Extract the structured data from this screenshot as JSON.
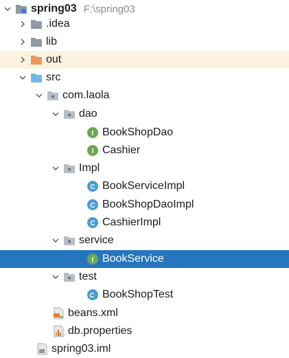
{
  "tree": {
    "root": {
      "name": "spring03",
      "path": "F:\\spring03"
    },
    "idea": ".idea",
    "lib": "lib",
    "out": "out",
    "src": "src",
    "pkg": "com.laola",
    "dao": "dao",
    "bookShopDao": "BookShopDao",
    "cashier": "Cashier",
    "impl": "Impl",
    "bookServiceImpl": "BookServiceImpl",
    "bookShopDaoImpl": "BookShopDaoImpl",
    "cashierImpl": "CashierImpl",
    "service": "service",
    "bookService": "BookService",
    "test": "test",
    "bookShopTest": "BookShopTest",
    "beans": "beans.xml",
    "dbprops": "db.properties",
    "iml": "spring03.iml"
  },
  "colors": {
    "selection": "#2675bf",
    "folder": "#8e9aa6",
    "out_folder": "#f0955b",
    "src_folder": "#6fb9e6",
    "interface": "#6aa84f",
    "class": "#4a9bd6"
  },
  "icons": {
    "expanded": "chevron-down-icon",
    "collapsed": "chevron-right-icon"
  }
}
